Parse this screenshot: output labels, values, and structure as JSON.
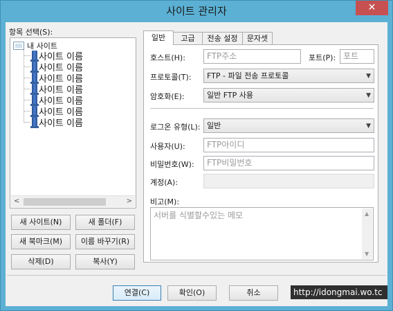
{
  "window": {
    "title": "사이트 관리자",
    "close_glyph": "✕"
  },
  "tree": {
    "label": "항목 선택(S):",
    "root": "내 사이트",
    "items": [
      "사이트 이름",
      "사이트 이름",
      "사이트 이름",
      "사이트 이름",
      "사이트 이름",
      "사이트 이름",
      "사이트 이름"
    ]
  },
  "left_buttons": {
    "new_site": "새 사이트(N)",
    "new_folder": "새 폴더(F)",
    "new_bookmark": "새 북마크(M)",
    "rename": "이름 바꾸기(R)",
    "delete": "삭제(D)",
    "copy": "복사(Y)"
  },
  "tabs": [
    "일반",
    "고급",
    "전송 설정",
    "문자셋"
  ],
  "general": {
    "host_label": "호스트(H):",
    "host_placeholder": "FTP주소",
    "port_label": "포트(P):",
    "port_placeholder": "포트",
    "protocol_label": "프로토콜(T):",
    "protocol_value": "FTP - 파일 전송 프로토콜",
    "encryption_label": "암호화(E):",
    "encryption_value": "일반 FTP 사용",
    "logon_label": "로그온 유형(L):",
    "logon_value": "일반",
    "user_label": "사용자(U):",
    "user_placeholder": "FTP아이디",
    "password_label": "비밀번호(W):",
    "password_placeholder": "FTP비밀번호",
    "account_label": "계정(A):",
    "memo_label": "비고(M):",
    "memo_placeholder": "서버를 식별할수있는 메모"
  },
  "footer": {
    "connect": "연결(C)",
    "ok": "확인(O)",
    "cancel": "취소"
  },
  "watermark": "http://idongmai.wo.tc"
}
